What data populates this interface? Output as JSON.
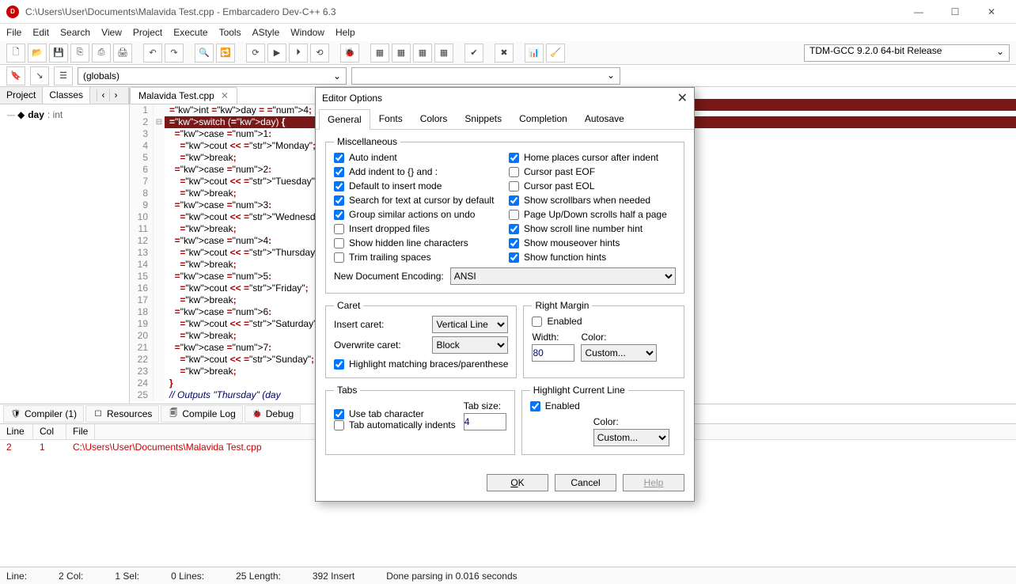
{
  "window": {
    "title": "C:\\Users\\User\\Documents\\Malavida Test.cpp - Embarcadero Dev-C++ 6.3"
  },
  "menu": [
    "File",
    "Edit",
    "Search",
    "View",
    "Project",
    "Execute",
    "Tools",
    "AStyle",
    "Window",
    "Help"
  ],
  "compiler_select": "TDM-GCC 9.2.0 64-bit Release",
  "globals": "(globals)",
  "left_tabs": {
    "project": "Project",
    "classes": "Classes"
  },
  "tree": {
    "var": "day",
    "type": ": int"
  },
  "editor_tab": "Malavida Test.cpp",
  "code": {
    "lines": [
      {
        "n": 1,
        "raw": "int day = 4;"
      },
      {
        "n": 2,
        "raw": "switch (day) {",
        "hl": true
      },
      {
        "n": 3,
        "raw": "  case 1:"
      },
      {
        "n": 4,
        "raw": "    cout << \"Monday\";"
      },
      {
        "n": 5,
        "raw": "    break;"
      },
      {
        "n": 6,
        "raw": "  case 2:"
      },
      {
        "n": 7,
        "raw": "    cout << \"Tuesday\";"
      },
      {
        "n": 8,
        "raw": "    break;"
      },
      {
        "n": 9,
        "raw": "  case 3:"
      },
      {
        "n": 10,
        "raw": "    cout << \"Wednesday\";"
      },
      {
        "n": 11,
        "raw": "    break;"
      },
      {
        "n": 12,
        "raw": "  case 4:"
      },
      {
        "n": 13,
        "raw": "    cout << \"Thursday\";"
      },
      {
        "n": 14,
        "raw": "    break;"
      },
      {
        "n": 15,
        "raw": "  case 5:"
      },
      {
        "n": 16,
        "raw": "    cout << \"Friday\";"
      },
      {
        "n": 17,
        "raw": "    break;"
      },
      {
        "n": 18,
        "raw": "  case 6:"
      },
      {
        "n": 19,
        "raw": "    cout << \"Saturday\";"
      },
      {
        "n": 20,
        "raw": "    break;"
      },
      {
        "n": 21,
        "raw": "  case 7:"
      },
      {
        "n": 22,
        "raw": "    cout << \"Sunday\";"
      },
      {
        "n": 23,
        "raw": "    break;"
      },
      {
        "n": 24,
        "raw": "}"
      },
      {
        "n": 25,
        "raw": "// Outputs \"Thursday\" (day"
      }
    ]
  },
  "bottom_tabs": {
    "compiler": "Compiler (1)",
    "resources": "Resources",
    "compile_log": "Compile Log",
    "debug": "Debug"
  },
  "errors": {
    "headers": {
      "line": "Line",
      "col": "Col",
      "file": "File"
    },
    "row": {
      "line": "2",
      "col": "1",
      "file": "C:\\Users\\User\\Documents\\Malavida Test.cpp"
    }
  },
  "status": {
    "line": "Line:",
    "col_label": "2 Col:",
    "sel": "1 Sel:",
    "lines": "0 Lines:",
    "len": "25 Length:",
    "ins": "392 Insert",
    "parse": "Done parsing in 0.016 seconds"
  },
  "dialog": {
    "title": "Editor Options",
    "tabs": [
      "General",
      "Fonts",
      "Colors",
      "Snippets",
      "Completion",
      "Autosave"
    ],
    "misc": {
      "legend": "Miscellaneous",
      "left": [
        {
          "l": "Auto indent",
          "c": true
        },
        {
          "l": "Add indent to {} and :",
          "c": true
        },
        {
          "l": "Default to insert mode",
          "c": true
        },
        {
          "l": "Search for text at cursor by default",
          "c": true
        },
        {
          "l": "Group similar actions on undo",
          "c": true
        },
        {
          "l": "Insert dropped files",
          "c": false
        },
        {
          "l": "Show hidden line characters",
          "c": false
        },
        {
          "l": "Trim trailing spaces",
          "c": false
        }
      ],
      "right": [
        {
          "l": "Home places cursor after indent",
          "c": true
        },
        {
          "l": "Cursor past EOF",
          "c": false
        },
        {
          "l": "Cursor past EOL",
          "c": false
        },
        {
          "l": "Show scrollbars when needed",
          "c": true
        },
        {
          "l": "Page Up/Down scrolls half a page",
          "c": false
        },
        {
          "l": "Show scroll line number hint",
          "c": true
        },
        {
          "l": "Show mouseover hints",
          "c": true
        },
        {
          "l": "Show function hints",
          "c": true
        }
      ],
      "encoding_label": "New Document Encoding:",
      "encoding": "ANSI"
    },
    "caret": {
      "legend": "Caret",
      "insert_label": "Insert caret:",
      "insert": "Vertical Line",
      "overwrite_label": "Overwrite caret:",
      "overwrite": "Block",
      "highlight": {
        "l": "Highlight matching braces/parenthese",
        "c": true
      }
    },
    "right_margin": {
      "legend": "Right Margin",
      "enabled": {
        "l": "Enabled",
        "c": false
      },
      "width_label": "Width:",
      "width": "80",
      "color_label": "Color:",
      "color": "Custom..."
    },
    "tabs_group": {
      "legend": "Tabs",
      "use": {
        "l": "Use tab character",
        "c": true
      },
      "auto": {
        "l": "Tab automatically indents",
        "c": false
      },
      "size_label": "Tab size:",
      "size": "4"
    },
    "hcl": {
      "legend": "Highlight Current Line",
      "enabled": {
        "l": "Enabled",
        "c": true
      },
      "color_label": "Color:",
      "color": "Custom..."
    },
    "buttons": {
      "ok": "OK",
      "cancel": "Cancel",
      "help": "Help"
    }
  }
}
